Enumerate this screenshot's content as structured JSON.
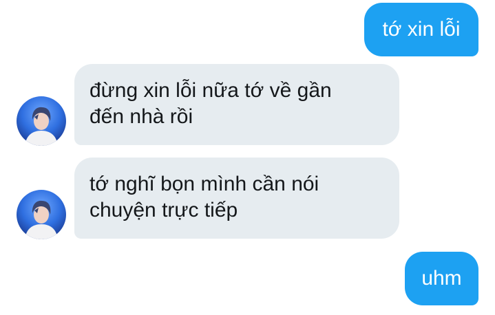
{
  "conversation": {
    "messages": [
      {
        "sender": "self",
        "text": "tớ xin lỗi"
      },
      {
        "sender": "other",
        "line1": "đừng xin lỗi nữa tớ về gần",
        "line2": "đến nhà rồi",
        "avatar_icon": "user-photo-avatar"
      },
      {
        "sender": "other",
        "line1": "tớ nghĩ bọn mình cần nói",
        "line2": "chuyện trực tiếp",
        "avatar_icon": "user-photo-avatar"
      },
      {
        "sender": "self",
        "text": "uhm"
      }
    ]
  },
  "colors": {
    "outgoing_bubble": "#1da1f2",
    "incoming_bubble": "#e6ecf0",
    "incoming_text": "#14171a",
    "background": "#ffffff"
  }
}
